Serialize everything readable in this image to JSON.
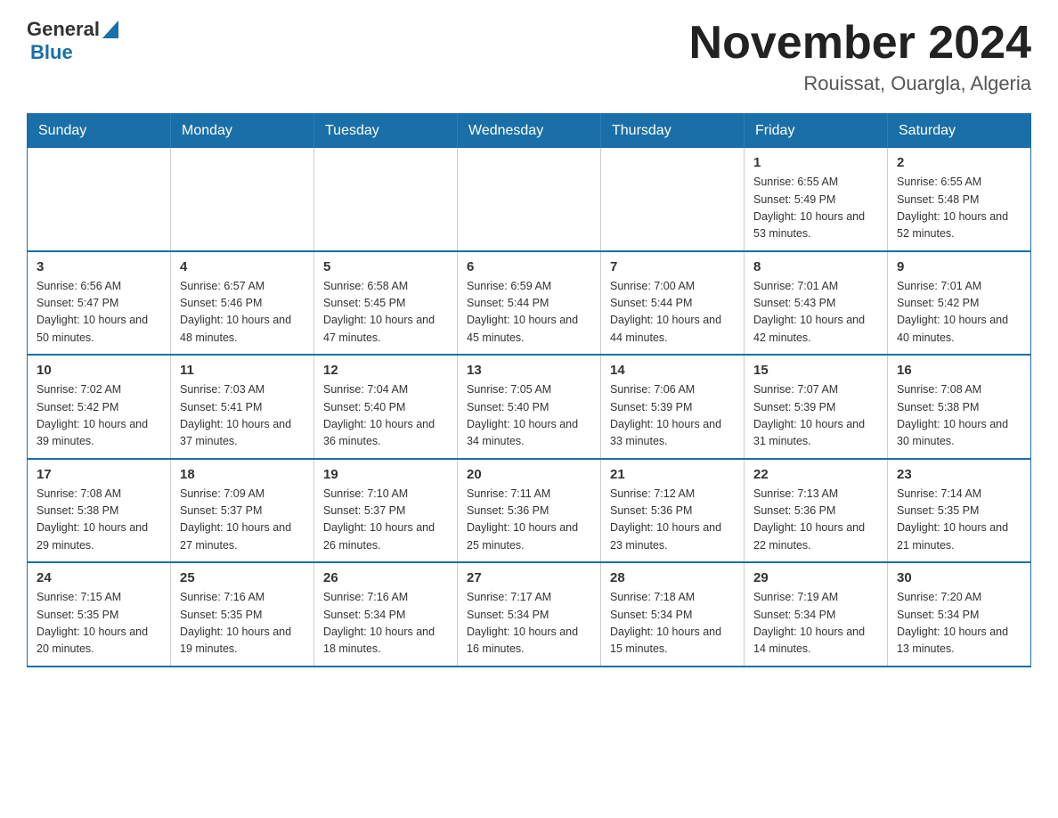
{
  "logo": {
    "general": "General",
    "blue": "Blue"
  },
  "title": {
    "month": "November 2024",
    "location": "Rouissat, Ouargla, Algeria"
  },
  "weekdays": [
    "Sunday",
    "Monday",
    "Tuesday",
    "Wednesday",
    "Thursday",
    "Friday",
    "Saturday"
  ],
  "weeks": [
    [
      {
        "day": "",
        "info": ""
      },
      {
        "day": "",
        "info": ""
      },
      {
        "day": "",
        "info": ""
      },
      {
        "day": "",
        "info": ""
      },
      {
        "day": "",
        "info": ""
      },
      {
        "day": "1",
        "info": "Sunrise: 6:55 AM\nSunset: 5:49 PM\nDaylight: 10 hours and 53 minutes."
      },
      {
        "day": "2",
        "info": "Sunrise: 6:55 AM\nSunset: 5:48 PM\nDaylight: 10 hours and 52 minutes."
      }
    ],
    [
      {
        "day": "3",
        "info": "Sunrise: 6:56 AM\nSunset: 5:47 PM\nDaylight: 10 hours and 50 minutes."
      },
      {
        "day": "4",
        "info": "Sunrise: 6:57 AM\nSunset: 5:46 PM\nDaylight: 10 hours and 48 minutes."
      },
      {
        "day": "5",
        "info": "Sunrise: 6:58 AM\nSunset: 5:45 PM\nDaylight: 10 hours and 47 minutes."
      },
      {
        "day": "6",
        "info": "Sunrise: 6:59 AM\nSunset: 5:44 PM\nDaylight: 10 hours and 45 minutes."
      },
      {
        "day": "7",
        "info": "Sunrise: 7:00 AM\nSunset: 5:44 PM\nDaylight: 10 hours and 44 minutes."
      },
      {
        "day": "8",
        "info": "Sunrise: 7:01 AM\nSunset: 5:43 PM\nDaylight: 10 hours and 42 minutes."
      },
      {
        "day": "9",
        "info": "Sunrise: 7:01 AM\nSunset: 5:42 PM\nDaylight: 10 hours and 40 minutes."
      }
    ],
    [
      {
        "day": "10",
        "info": "Sunrise: 7:02 AM\nSunset: 5:42 PM\nDaylight: 10 hours and 39 minutes."
      },
      {
        "day": "11",
        "info": "Sunrise: 7:03 AM\nSunset: 5:41 PM\nDaylight: 10 hours and 37 minutes."
      },
      {
        "day": "12",
        "info": "Sunrise: 7:04 AM\nSunset: 5:40 PM\nDaylight: 10 hours and 36 minutes."
      },
      {
        "day": "13",
        "info": "Sunrise: 7:05 AM\nSunset: 5:40 PM\nDaylight: 10 hours and 34 minutes."
      },
      {
        "day": "14",
        "info": "Sunrise: 7:06 AM\nSunset: 5:39 PM\nDaylight: 10 hours and 33 minutes."
      },
      {
        "day": "15",
        "info": "Sunrise: 7:07 AM\nSunset: 5:39 PM\nDaylight: 10 hours and 31 minutes."
      },
      {
        "day": "16",
        "info": "Sunrise: 7:08 AM\nSunset: 5:38 PM\nDaylight: 10 hours and 30 minutes."
      }
    ],
    [
      {
        "day": "17",
        "info": "Sunrise: 7:08 AM\nSunset: 5:38 PM\nDaylight: 10 hours and 29 minutes."
      },
      {
        "day": "18",
        "info": "Sunrise: 7:09 AM\nSunset: 5:37 PM\nDaylight: 10 hours and 27 minutes."
      },
      {
        "day": "19",
        "info": "Sunrise: 7:10 AM\nSunset: 5:37 PM\nDaylight: 10 hours and 26 minutes."
      },
      {
        "day": "20",
        "info": "Sunrise: 7:11 AM\nSunset: 5:36 PM\nDaylight: 10 hours and 25 minutes."
      },
      {
        "day": "21",
        "info": "Sunrise: 7:12 AM\nSunset: 5:36 PM\nDaylight: 10 hours and 23 minutes."
      },
      {
        "day": "22",
        "info": "Sunrise: 7:13 AM\nSunset: 5:36 PM\nDaylight: 10 hours and 22 minutes."
      },
      {
        "day": "23",
        "info": "Sunrise: 7:14 AM\nSunset: 5:35 PM\nDaylight: 10 hours and 21 minutes."
      }
    ],
    [
      {
        "day": "24",
        "info": "Sunrise: 7:15 AM\nSunset: 5:35 PM\nDaylight: 10 hours and 20 minutes."
      },
      {
        "day": "25",
        "info": "Sunrise: 7:16 AM\nSunset: 5:35 PM\nDaylight: 10 hours and 19 minutes."
      },
      {
        "day": "26",
        "info": "Sunrise: 7:16 AM\nSunset: 5:34 PM\nDaylight: 10 hours and 18 minutes."
      },
      {
        "day": "27",
        "info": "Sunrise: 7:17 AM\nSunset: 5:34 PM\nDaylight: 10 hours and 16 minutes."
      },
      {
        "day": "28",
        "info": "Sunrise: 7:18 AM\nSunset: 5:34 PM\nDaylight: 10 hours and 15 minutes."
      },
      {
        "day": "29",
        "info": "Sunrise: 7:19 AM\nSunset: 5:34 PM\nDaylight: 10 hours and 14 minutes."
      },
      {
        "day": "30",
        "info": "Sunrise: 7:20 AM\nSunset: 5:34 PM\nDaylight: 10 hours and 13 minutes."
      }
    ]
  ]
}
